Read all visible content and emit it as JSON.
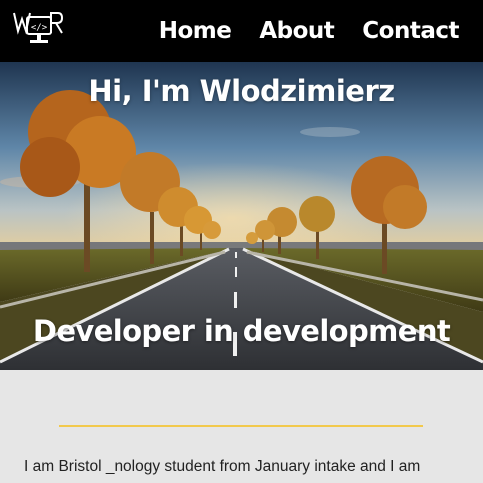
{
  "nav": {
    "logo_alt": "W</>R",
    "links": [
      {
        "label": "Home"
      },
      {
        "label": "About"
      },
      {
        "label": "Contact"
      }
    ]
  },
  "hero": {
    "title": "Hi, I'm Wlodzimierz",
    "subtitle": "Developer in development",
    "image": "road-lined-with-autumn-trees-icon"
  },
  "colors": {
    "navbar": "#000000",
    "accent_divider": "#f2c94c",
    "page_background": "#e6e6e6"
  },
  "intro": {
    "text": "I am Bristol _nology student from January intake and I am"
  }
}
